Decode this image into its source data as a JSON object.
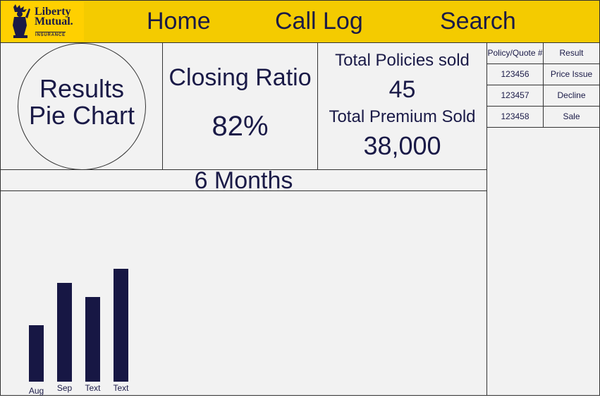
{
  "header": {
    "logo": {
      "line1": "Liberty",
      "line2": "Mutual.",
      "line3": "INSURANCE"
    },
    "nav": [
      {
        "label": "Home"
      },
      {
        "label": "Call Log"
      },
      {
        "label": "Search"
      }
    ]
  },
  "results": {
    "label_line1": "Results",
    "label_line2": "Pie Chart"
  },
  "closing": {
    "title": "Closing Ratio",
    "value": "82%"
  },
  "totals": {
    "policies_label": "Total Policies sold",
    "policies_value": "45",
    "premium_label": "Total Premium Sold",
    "premium_value": "38,000"
  },
  "period": {
    "label": "6 Months"
  },
  "table": {
    "headers": [
      "Policy/Quote #",
      "Result"
    ],
    "rows": [
      [
        "123456",
        "Price Issue"
      ],
      [
        "123457",
        "Decline"
      ],
      [
        "123458",
        "Sale"
      ]
    ]
  },
  "chart_data": {
    "type": "bar",
    "categories": [
      "Aug",
      "Sep",
      "Text",
      "Text"
    ],
    "values": [
      4,
      7,
      6,
      8
    ],
    "ylim": [
      0,
      8
    ],
    "title": "",
    "xlabel": "",
    "ylabel": "",
    "bar_color": "#171744"
  },
  "colors": {
    "header_bg": "#f4cb00",
    "text": "#1a1a47",
    "panel_bg": "#f2f2f2"
  }
}
